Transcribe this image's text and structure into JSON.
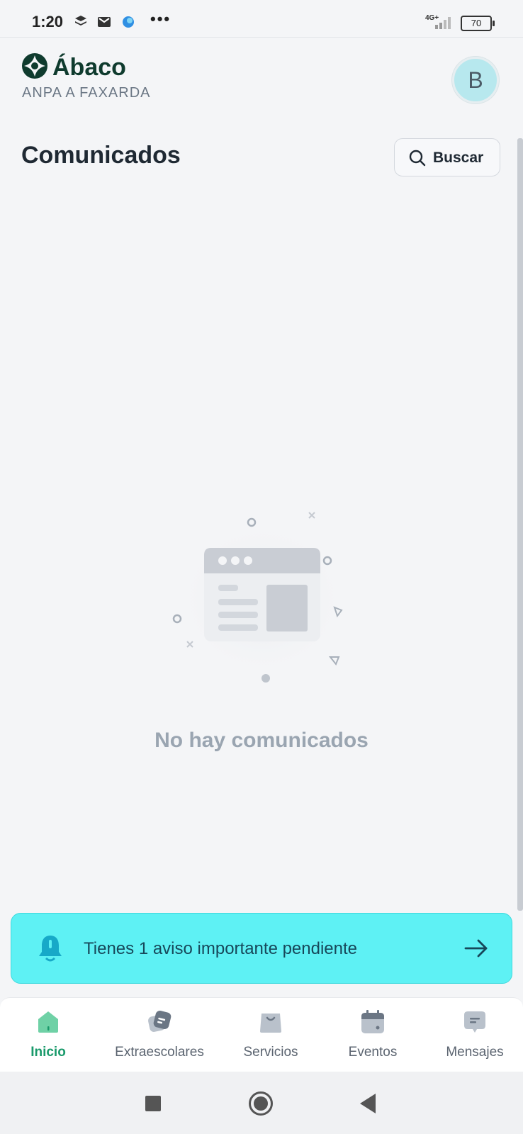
{
  "status_bar": {
    "time": "1:20",
    "network": "4G+",
    "battery": "70"
  },
  "header": {
    "brand": "Ábaco",
    "organization": "ANPA A FAXARDA",
    "avatar_initial": "B"
  },
  "main": {
    "title": "Comunicados",
    "search_label": "Buscar",
    "empty_message": "No hay comunicados"
  },
  "notice": {
    "text": "Tienes 1 aviso importante pendiente"
  },
  "bottom_nav": {
    "items": [
      {
        "label": "Inicio",
        "icon": "home-icon",
        "active": true
      },
      {
        "label": "Extraescolares",
        "icon": "activities-icon",
        "active": false
      },
      {
        "label": "Servicios",
        "icon": "shopping-bag-icon",
        "active": false
      },
      {
        "label": "Eventos",
        "icon": "calendar-icon",
        "active": false
      },
      {
        "label": "Mensajes",
        "icon": "message-icon",
        "active": false
      }
    ]
  },
  "colors": {
    "brand": "#0f3b2e",
    "active_nav": "#1a9a6b",
    "notice_bg": "#5ef1f4",
    "avatar_bg": "#b7e8ee"
  }
}
